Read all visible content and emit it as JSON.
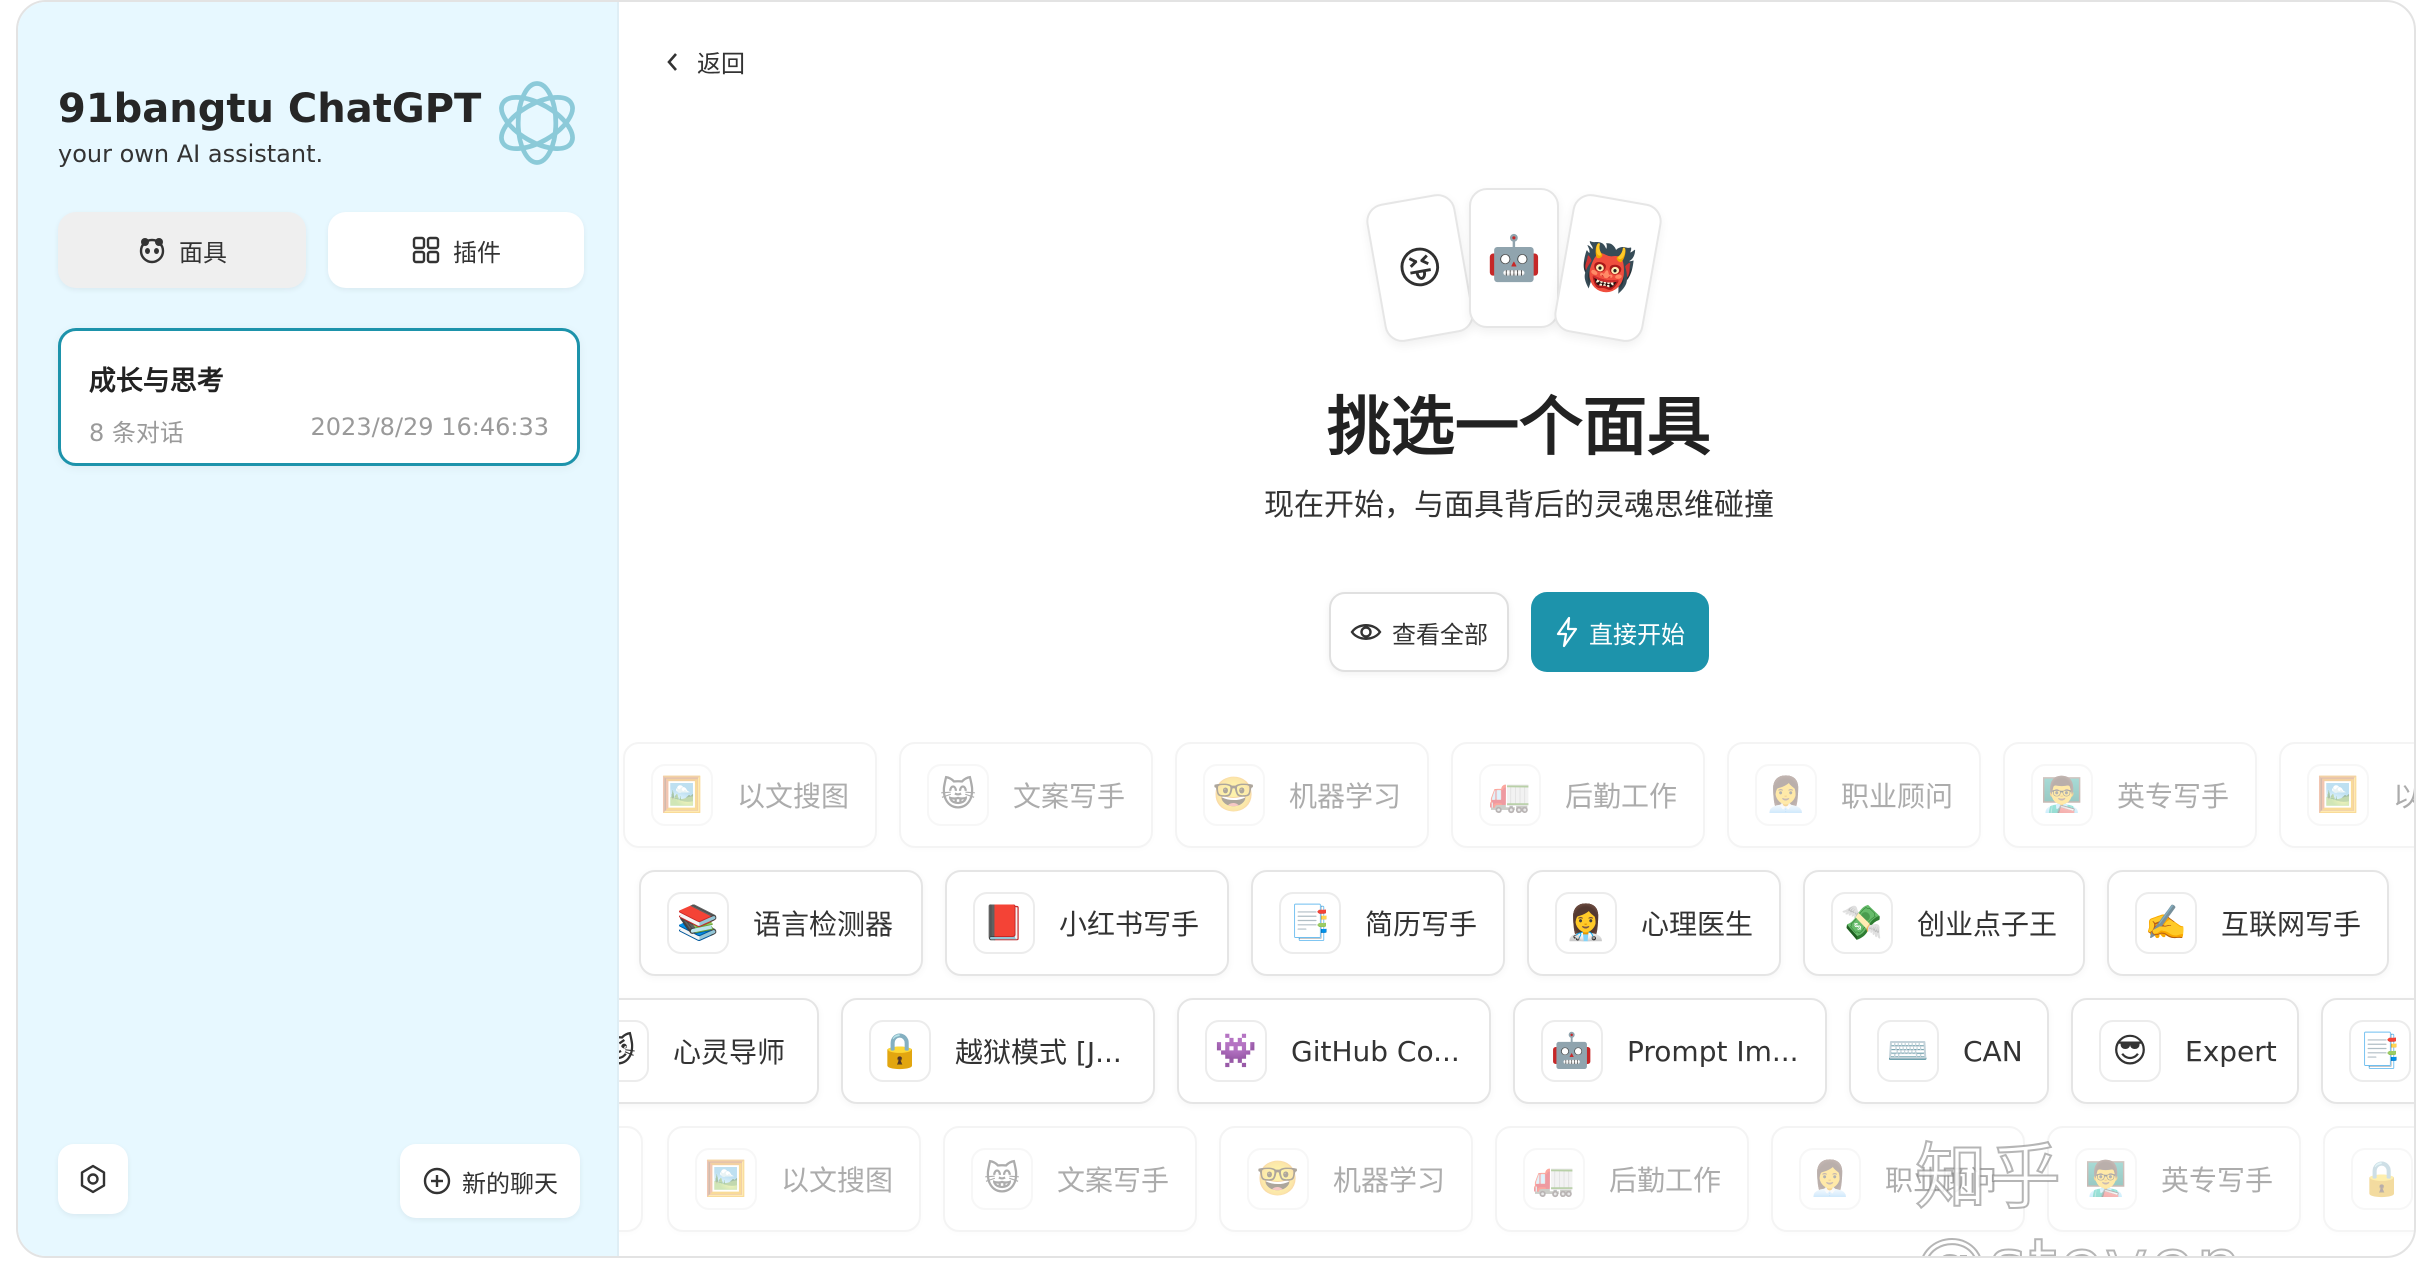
{
  "sidebar": {
    "title": "91bangtu ChatGPT",
    "subtitle": "your own AI assistant.",
    "masks_button": "面具",
    "plugins_button": "插件",
    "chats": [
      {
        "title": "成长与思考",
        "count": "8 条对话",
        "time": "2023/8/29 16:46:33"
      }
    ],
    "new_chat": "新的聊天"
  },
  "main": {
    "back": "返回",
    "emoji_cards": [
      "😝",
      "🤖",
      "👹"
    ],
    "title": "挑选一个面具",
    "subtitle": "现在开始，与面具背后的灵魂思维碰撞",
    "view_all": "查看全部",
    "start": "直接开始"
  },
  "mask_rows": [
    [
      {
        "emoji": "🖼️",
        "name": "以文搜图"
      },
      {
        "emoji": "😸",
        "name": "文案写手"
      },
      {
        "emoji": "🤓",
        "name": "机器学习"
      },
      {
        "emoji": "🚛",
        "name": "后勤工作"
      },
      {
        "emoji": "👩‍💼",
        "name": "职业顾问"
      },
      {
        "emoji": "👨‍🏫",
        "name": "英专写手"
      },
      {
        "emoji": "🖼️",
        "name": "以"
      }
    ],
    [
      {
        "emoji": "📚",
        "name": "语言检测器"
      },
      {
        "emoji": "📕",
        "name": "小红书写手"
      },
      {
        "emoji": "📑",
        "name": "简历写手"
      },
      {
        "emoji": "👩‍⚕️",
        "name": "心理医生"
      },
      {
        "emoji": "💸",
        "name": "创业点子王"
      },
      {
        "emoji": "✍️",
        "name": "互联网写手"
      }
    ],
    [
      {
        "emoji": "😼",
        "name": "心灵导师"
      },
      {
        "emoji": "🔒",
        "name": "越狱模式 [J..."
      },
      {
        "emoji": "👾",
        "name": "GitHub Co..."
      },
      {
        "emoji": "🤖",
        "name": "Prompt Im..."
      },
      {
        "emoji": "⌨️",
        "name": "CAN"
      },
      {
        "emoji": "😎",
        "name": "Expert"
      },
      {
        "emoji": "📑",
        "name": ""
      }
    ],
    [
      {
        "emoji": "",
        "name": ""
      },
      {
        "emoji": "🖼️",
        "name": "以文搜图"
      },
      {
        "emoji": "😸",
        "name": "文案写手"
      },
      {
        "emoji": "🤓",
        "name": "机器学习"
      },
      {
        "emoji": "🚛",
        "name": "后勤工作"
      },
      {
        "emoji": "👩‍💼",
        "name": "职业顾问"
      },
      {
        "emoji": "👨‍🏫",
        "name": "英专写手"
      },
      {
        "emoji": "🔒",
        "name": ""
      }
    ]
  ],
  "watermark": "知乎 @steven",
  "colors": {
    "accent": "#1d93ab",
    "sidebar_bg": "#e7f8ff"
  }
}
